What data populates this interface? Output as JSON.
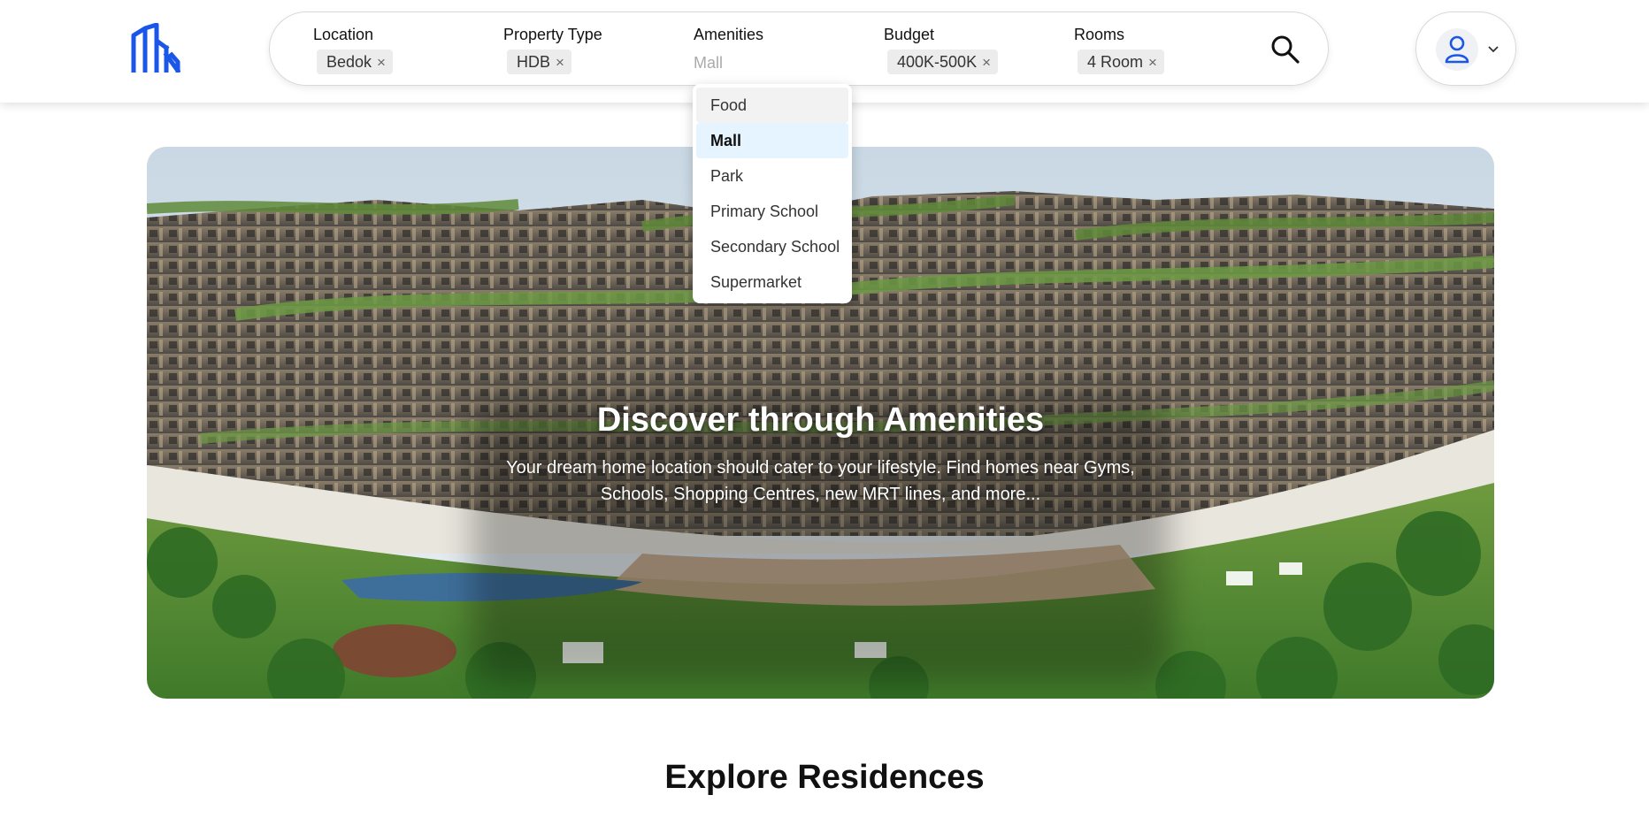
{
  "filters": {
    "location": {
      "label": "Location",
      "chip": "Bedok"
    },
    "property_type": {
      "label": "Property Type",
      "chip": "HDB"
    },
    "amenities": {
      "label": "Amenities",
      "placeholder": "Mall"
    },
    "budget": {
      "label": "Budget",
      "chip": "400K-500K"
    },
    "rooms": {
      "label": "Rooms",
      "chip": "4 Room"
    },
    "remove_glyph": "×"
  },
  "amenities_dropdown": {
    "options": [
      "Food",
      "Mall",
      "Park",
      "Primary School",
      "Secondary School",
      "Supermarket"
    ],
    "hovered": "Food",
    "selected": "Mall"
  },
  "hero": {
    "title": "Discover through Amenities",
    "subtitle": "Your dream home location should cater to your lifestyle. Find homes near Gyms, Schools, Shopping Centres, new MRT lines, and more..."
  },
  "section": {
    "title": "Explore Residences"
  },
  "colors": {
    "brand": "#1a56e8",
    "selected_bg": "#e6f4ff"
  },
  "icons": {
    "logo": "building-logo-icon",
    "search": "search-icon",
    "user": "user-icon",
    "chevron": "chevron-down-icon"
  }
}
